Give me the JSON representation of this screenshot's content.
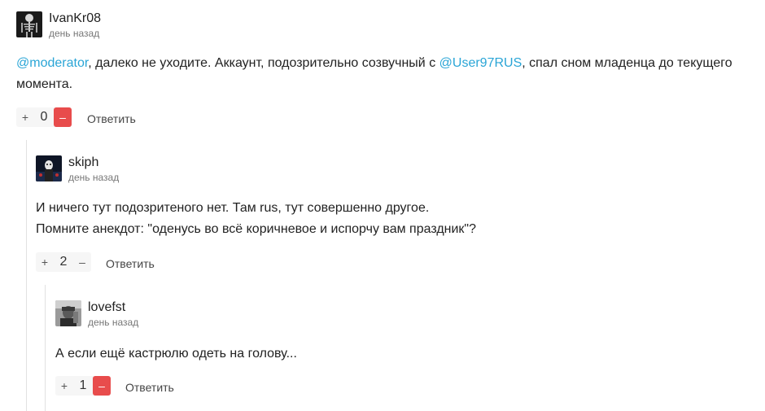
{
  "comments": [
    {
      "author": "IvanKr08",
      "time": "день назад",
      "text_parts": {
        "mention1": "@moderator",
        "t1": ", далеко не уходите. Аккаунт, подозрительно созвучный с ",
        "mention2": "@User97RUS",
        "t2": ", спал сном младенца до текущего",
        "line2": "момента."
      },
      "vote_plus": "+",
      "vote_count": "0",
      "vote_minus": "–",
      "reply_label": "Ответить"
    },
    {
      "author": "skiph",
      "time": "день назад",
      "line1": "И ничего тут подозритеного нет. Там rus, тут совершенно другое.",
      "line2": "Помните анекдот: \"оденусь во всё коричневое и испорчу вам праздник\"?",
      "vote_plus": "+",
      "vote_count": "2",
      "vote_minus": "–",
      "reply_label": "Ответить"
    },
    {
      "author": "lovefst",
      "time": "день назад",
      "line1": "А если ещё кастрюлю одеть на голову...",
      "vote_plus": "+",
      "vote_count": "1",
      "vote_minus": "–",
      "reply_label": "Ответить"
    }
  ],
  "colors": {
    "mention": "#2aa5d6",
    "downvote_active": "#e84c4c",
    "thread_line": "#e1e1e1"
  }
}
